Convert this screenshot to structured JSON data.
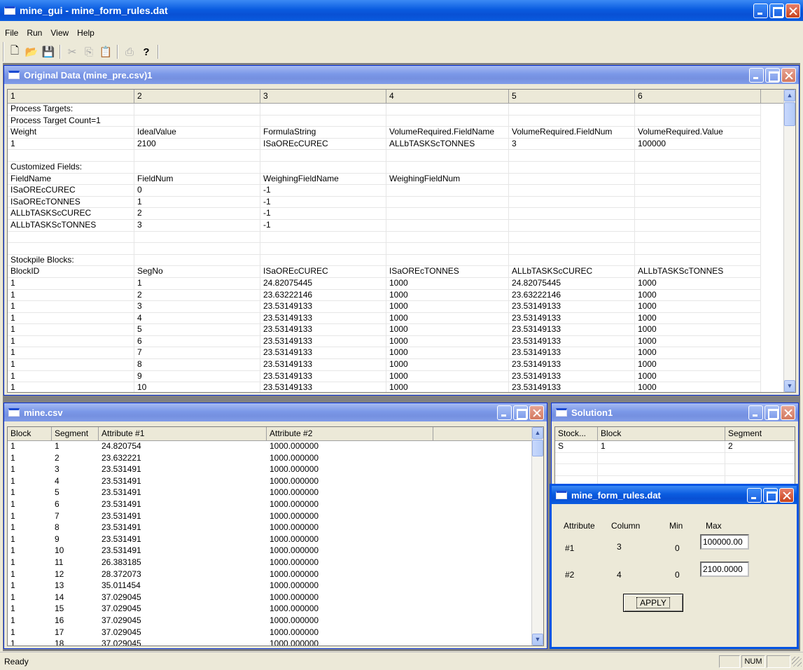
{
  "app": {
    "title": "mine_gui - mine_form_rules.dat",
    "status": "Ready",
    "num": "NUM"
  },
  "menu": [
    "File",
    "Run",
    "View",
    "Help"
  ],
  "toolbar": [
    {
      "icon": "new-file-icon",
      "glyph": "🗋"
    },
    {
      "icon": "open-folder-icon",
      "glyph": "📂"
    },
    {
      "icon": "save-icon",
      "glyph": "💾"
    },
    {
      "icon": "cut-icon",
      "glyph": "✂"
    },
    {
      "icon": "copy-icon",
      "glyph": "⎘"
    },
    {
      "icon": "paste-icon",
      "glyph": "📋"
    },
    {
      "icon": "print-icon",
      "glyph": "⎙"
    },
    {
      "icon": "help-icon",
      "glyph": "?"
    }
  ],
  "original": {
    "title": "Original Data (mine_pre.csv)1",
    "headers": [
      "1",
      "2",
      "3",
      "4",
      "5",
      "6"
    ],
    "rows": [
      [
        "Process Targets:",
        "",
        "",
        "",
        "",
        ""
      ],
      [
        "Process Target Count=1",
        "",
        "",
        "",
        "",
        ""
      ],
      [
        "Weight",
        "IdealValue",
        "FormulaString",
        "VolumeRequired.FieldName",
        "VolumeRequired.FieldNum",
        "VolumeRequired.Value"
      ],
      [
        "1",
        "2100",
        "ISaOREcCUREC",
        "ALLbTASKScTONNES",
        "3",
        "100000"
      ],
      [
        "",
        "",
        "",
        "",
        "",
        ""
      ],
      [
        "Customized Fields:",
        "",
        "",
        "",
        "",
        ""
      ],
      [
        "FieldName",
        "FieldNum",
        "WeighingFieldName",
        "WeighingFieldNum",
        "",
        ""
      ],
      [
        "ISaOREcCUREC",
        "0",
        "-1",
        "",
        "",
        ""
      ],
      [
        "ISaOREcTONNES",
        "1",
        "-1",
        "",
        "",
        ""
      ],
      [
        "ALLbTASKScCUREC",
        "2",
        "-1",
        "",
        "",
        ""
      ],
      [
        "ALLbTASKScTONNES",
        "3",
        "-1",
        "",
        "",
        ""
      ],
      [
        "",
        "",
        "",
        "",
        "",
        ""
      ],
      [
        "",
        "",
        "",
        "",
        "",
        ""
      ],
      [
        "Stockpile Blocks:",
        "",
        "",
        "",
        "",
        ""
      ],
      [
        "BlockID",
        "SegNo",
        "ISaOREcCUREC",
        "ISaOREcTONNES",
        "ALLbTASKScCUREC",
        "ALLbTASKScTONNES"
      ],
      [
        "1",
        "1",
        "24.82075445",
        "1000",
        "24.82075445",
        "1000"
      ],
      [
        "1",
        "2",
        "23.63222146",
        "1000",
        "23.63222146",
        "1000"
      ],
      [
        "1",
        "3",
        "23.53149133",
        "1000",
        "23.53149133",
        "1000"
      ],
      [
        "1",
        "4",
        "23.53149133",
        "1000",
        "23.53149133",
        "1000"
      ],
      [
        "1",
        "5",
        "23.53149133",
        "1000",
        "23.53149133",
        "1000"
      ],
      [
        "1",
        "6",
        "23.53149133",
        "1000",
        "23.53149133",
        "1000"
      ],
      [
        "1",
        "7",
        "23.53149133",
        "1000",
        "23.53149133",
        "1000"
      ],
      [
        "1",
        "8",
        "23.53149133",
        "1000",
        "23.53149133",
        "1000"
      ],
      [
        "1",
        "9",
        "23.53149133",
        "1000",
        "23.53149133",
        "1000"
      ],
      [
        "1",
        "10",
        "23.53149133",
        "1000",
        "23.53149133",
        "1000"
      ]
    ]
  },
  "mine": {
    "title": "mine.csv",
    "headers": [
      "Block",
      "Segment",
      "Attribute #1",
      "Attribute #2",
      ""
    ],
    "rows": [
      [
        "1",
        "1",
        "24.820754",
        "1000.000000"
      ],
      [
        "1",
        "2",
        "23.632221",
        "1000.000000"
      ],
      [
        "1",
        "3",
        "23.531491",
        "1000.000000"
      ],
      [
        "1",
        "4",
        "23.531491",
        "1000.000000"
      ],
      [
        "1",
        "5",
        "23.531491",
        "1000.000000"
      ],
      [
        "1",
        "6",
        "23.531491",
        "1000.000000"
      ],
      [
        "1",
        "7",
        "23.531491",
        "1000.000000"
      ],
      [
        "1",
        "8",
        "23.531491",
        "1000.000000"
      ],
      [
        "1",
        "9",
        "23.531491",
        "1000.000000"
      ],
      [
        "1",
        "10",
        "23.531491",
        "1000.000000"
      ],
      [
        "1",
        "11",
        "26.383185",
        "1000.000000"
      ],
      [
        "1",
        "12",
        "28.372073",
        "1000.000000"
      ],
      [
        "1",
        "13",
        "35.011454",
        "1000.000000"
      ],
      [
        "1",
        "14",
        "37.029045",
        "1000.000000"
      ],
      [
        "1",
        "15",
        "37.029045",
        "1000.000000"
      ],
      [
        "1",
        "16",
        "37.029045",
        "1000.000000"
      ],
      [
        "1",
        "17",
        "37.029045",
        "1000.000000"
      ],
      [
        "1",
        "18",
        "37.029045",
        "1000.000000"
      ]
    ]
  },
  "solution": {
    "title": "Solution1",
    "headers": [
      "Stock...",
      "Block",
      "Segment"
    ],
    "rows": [
      [
        "S",
        "1",
        "2"
      ]
    ]
  },
  "rules": {
    "title": "mine_form_rules.dat",
    "col_attribute": "Attribute",
    "col_column": "Column",
    "col_min": "Min",
    "col_max": "Max",
    "r1": {
      "attr": "#1",
      "column": "3",
      "min": "0",
      "max": "100000.00"
    },
    "r2": {
      "attr": "#2",
      "column": "4",
      "min": "0",
      "max": "2100.0000"
    },
    "apply": "APPLY"
  }
}
